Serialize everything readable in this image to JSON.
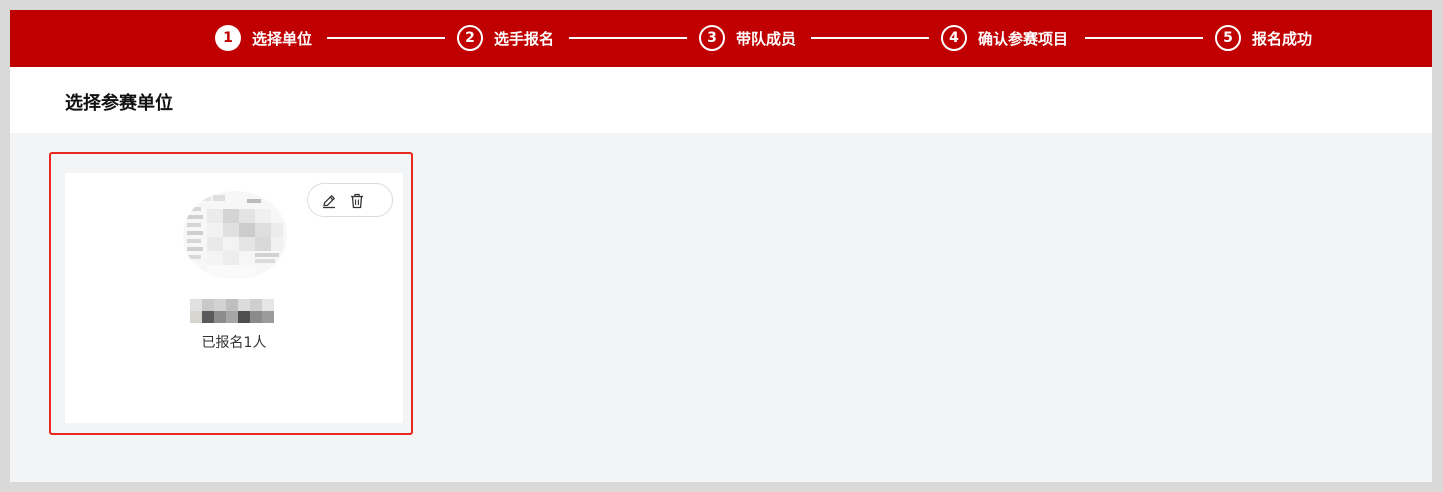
{
  "stepper": {
    "steps": [
      {
        "number": "1",
        "label": "选择单位",
        "active": true
      },
      {
        "number": "2",
        "label": "选手报名",
        "active": false
      },
      {
        "number": "3",
        "label": "带队成员",
        "active": false
      },
      {
        "number": "4",
        "label": "确认参赛项目",
        "active": false
      },
      {
        "number": "5",
        "label": "报名成功",
        "active": false
      }
    ]
  },
  "header": {
    "title": "选择参赛单位"
  },
  "units": [
    {
      "name_redacted": true,
      "registered_count": "已报名1人",
      "actions": {
        "edit_icon": "pencil-icon",
        "delete_icon": "trash-icon"
      }
    }
  ],
  "colors": {
    "brand": "#c00000",
    "highlight_border": "#e8271d",
    "page_background": "#f3f4f6"
  }
}
